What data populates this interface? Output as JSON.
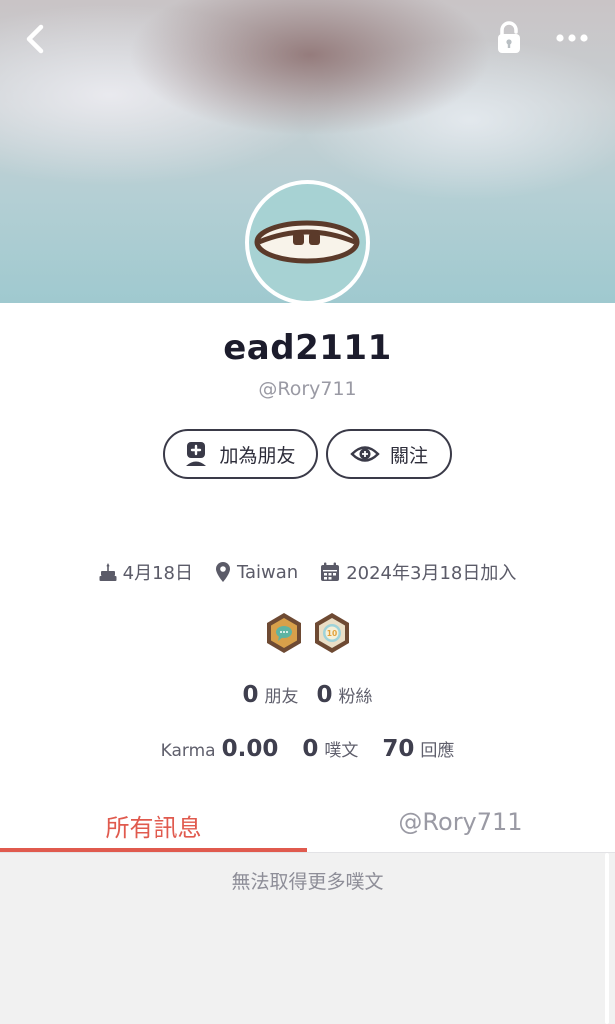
{
  "profile": {
    "display_name": "ead2111",
    "handle": "@Rory711"
  },
  "actions": {
    "add_friend_label": "加為朋友",
    "follow_label": "關注"
  },
  "meta": {
    "birthday": "4月18日",
    "location": "Taiwan",
    "joined": "2024年3月18日加入"
  },
  "badges": [
    {
      "icon": "chat-badge-icon"
    },
    {
      "icon": "ten-badge-icon",
      "text": "10"
    }
  ],
  "counts": {
    "friends_value": "0",
    "friends_label": "朋友",
    "fans_value": "0",
    "fans_label": "粉絲"
  },
  "stats": {
    "karma_label": "Karma",
    "karma_value": "0.00",
    "posts_value": "0",
    "posts_label": "噗文",
    "replies_value": "70",
    "replies_label": "回應"
  },
  "tabs": [
    {
      "label": "所有訊息",
      "active": true
    },
    {
      "label": "@Rory711",
      "active": false
    }
  ],
  "feed": {
    "empty_message": "無法取得更多噗文"
  },
  "colors": {
    "accent": "#e05a4e",
    "avatar_bg": "#a7d2d3",
    "badge_brown": "#6e4a33"
  }
}
